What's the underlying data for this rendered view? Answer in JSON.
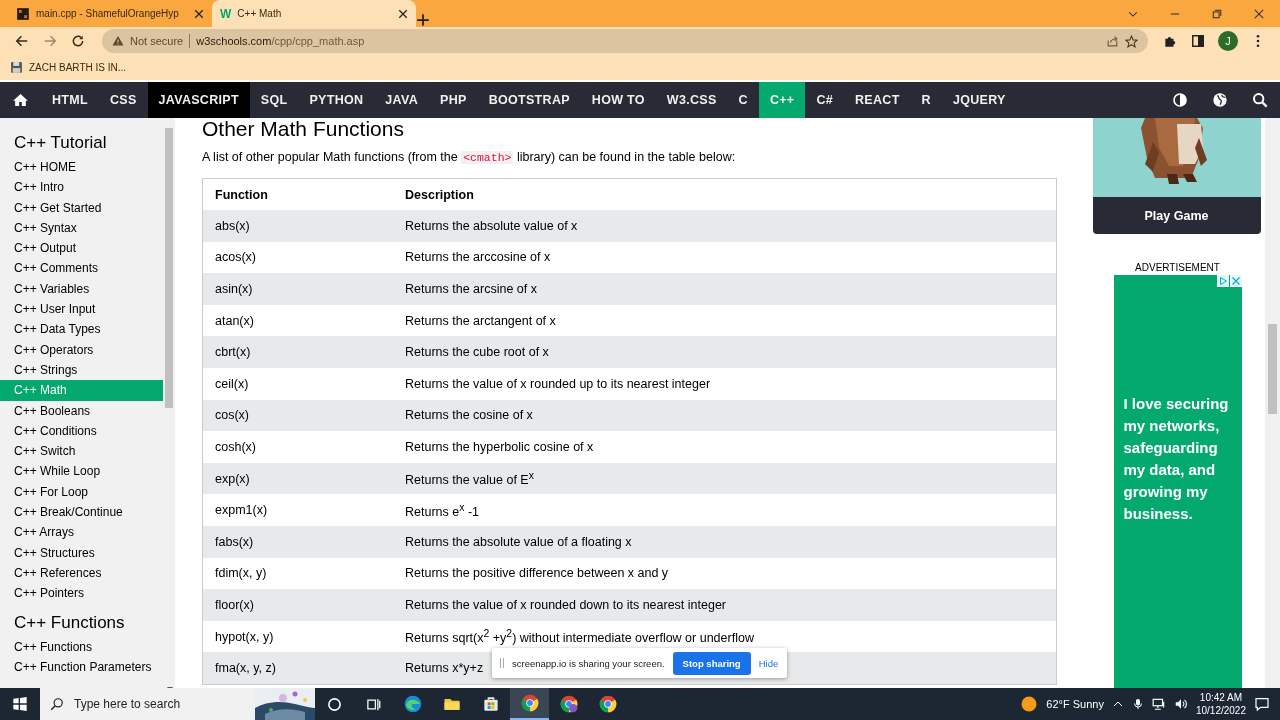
{
  "browser": {
    "tabs": [
      {
        "kind": "replit",
        "title": "main.cpp - ShamefulOrangeHyp",
        "selected": false
      },
      {
        "kind": "w3",
        "favicon": "W",
        "title": "C++ Math",
        "selected": true
      }
    ],
    "security": "Not secure",
    "url_host": "w3schools.com",
    "url_path": "/cpp/cpp_math.asp",
    "avatar": "J",
    "bookmarks": [
      {
        "label": "ZACH BARTH IS IN..."
      }
    ]
  },
  "nav": {
    "items": [
      {
        "label": "HTML",
        "selected": false,
        "hovered": false
      },
      {
        "label": "CSS",
        "selected": false,
        "hovered": false
      },
      {
        "label": "JAVASCRIPT",
        "selected": false,
        "hovered": true
      },
      {
        "label": "SQL",
        "selected": false,
        "hovered": false
      },
      {
        "label": "PYTHON",
        "selected": false,
        "hovered": false
      },
      {
        "label": "JAVA",
        "selected": false,
        "hovered": false
      },
      {
        "label": "PHP",
        "selected": false,
        "hovered": false
      },
      {
        "label": "BOOTSTRAP",
        "selected": false,
        "hovered": false
      },
      {
        "label": "HOW TO",
        "selected": false,
        "hovered": false
      },
      {
        "label": "W3.CSS",
        "selected": false,
        "hovered": false
      },
      {
        "label": "C",
        "selected": false,
        "hovered": false
      },
      {
        "label": "C++",
        "selected": true,
        "hovered": false
      },
      {
        "label": "C#",
        "selected": false,
        "hovered": false
      },
      {
        "label": "REACT",
        "selected": false,
        "hovered": false
      },
      {
        "label": "R",
        "selected": false,
        "hovered": false
      },
      {
        "label": "JQUERY",
        "selected": false,
        "hovered": false
      }
    ]
  },
  "sidebar": {
    "sections": [
      {
        "title": "C++ Tutorial",
        "items": [
          {
            "label": "C++ HOME",
            "selected": false
          },
          {
            "label": "C++ Intro",
            "selected": false
          },
          {
            "label": "C++ Get Started",
            "selected": false
          },
          {
            "label": "C++ Syntax",
            "selected": false
          },
          {
            "label": "C++ Output",
            "selected": false
          },
          {
            "label": "C++ Comments",
            "selected": false
          },
          {
            "label": "C++ Variables",
            "selected": false
          },
          {
            "label": "C++ User Input",
            "selected": false
          },
          {
            "label": "C++ Data Types",
            "selected": false
          },
          {
            "label": "C++ Operators",
            "selected": false
          },
          {
            "label": "C++ Strings",
            "selected": false
          },
          {
            "label": "C++ Math",
            "selected": true
          },
          {
            "label": "C++ Booleans",
            "selected": false
          },
          {
            "label": "C++ Conditions",
            "selected": false
          },
          {
            "label": "C++ Switch",
            "selected": false
          },
          {
            "label": "C++ While Loop",
            "selected": false
          },
          {
            "label": "C++ For Loop",
            "selected": false
          },
          {
            "label": "C++ Break/Continue",
            "selected": false
          },
          {
            "label": "C++ Arrays",
            "selected": false
          },
          {
            "label": "C++ Structures",
            "selected": false
          },
          {
            "label": "C++ References",
            "selected": false
          },
          {
            "label": "C++ Pointers",
            "selected": false
          }
        ]
      },
      {
        "title": "C++ Functions",
        "items": [
          {
            "label": "C++ Functions",
            "selected": false
          },
          {
            "label": "C++ Function Parameters",
            "selected": false
          }
        ]
      }
    ]
  },
  "main": {
    "heading": "Other Math Functions",
    "intro": {
      "before": "A list of other popular Math functions (from the ",
      "code": "<cmath>",
      "after": " library) can be found in the table below:"
    },
    "table": {
      "columns": [
        "Function",
        "Description"
      ],
      "rows": [
        {
          "function": "abs(x)",
          "description": "Returns the absolute value of x"
        },
        {
          "function": "acos(x)",
          "description": "Returns the arccosine of x"
        },
        {
          "function": "asin(x)",
          "description": "Returns the arcsine of x"
        },
        {
          "function": "atan(x)",
          "description": "Returns the arctangent of x"
        },
        {
          "function": "cbrt(x)",
          "description": "Returns the cube root of x"
        },
        {
          "function": "ceil(x)",
          "description": "Returns the value of x rounded up to its nearest integer"
        },
        {
          "function": "cos(x)",
          "description": "Returns the cosine of x"
        },
        {
          "function": "cosh(x)",
          "description": "Returns the hyperbolic cosine of x"
        },
        {
          "function": "exp(x)",
          "description": "Returns the value of E$^{x}$"
        },
        {
          "function": "expm1(x)",
          "description": "Returns e$^{x}$ -1"
        },
        {
          "function": "fabs(x)",
          "description": "Returns the absolute value of a floating x"
        },
        {
          "function": "fdim(x, y)",
          "description": "Returns the positive difference between x and y"
        },
        {
          "function": "floor(x)",
          "description": "Returns the value of x rounded down to its nearest integer"
        },
        {
          "function": "hypot(x, y)",
          "description": "Returns sqrt(x$^{2}$ +y$^{2}$) without intermediate overflow or underflow"
        },
        {
          "function": "fma(x, y, z)",
          "description": "Returns x*y+z"
        }
      ]
    }
  },
  "aside": {
    "game": {
      "kind": "picture",
      "button": "Play Game"
    },
    "ad_label": "ADVERTISEMENT",
    "ad_text": "I love securing my networks, safeguarding my data, and growing my business."
  },
  "share_bar": {
    "message": "screenapp.io is sharing your screen.",
    "stop": "Stop sharing",
    "hide": "Hide"
  },
  "taskbar": {
    "search_placeholder": "Type here to search",
    "weather": "62°F Sunny",
    "time": "10:42 AM",
    "date": "10/12/2022",
    "apps": [
      {
        "kind": "edge",
        "active": false
      },
      {
        "kind": "explorer",
        "active": false
      },
      {
        "kind": "store",
        "active": false
      },
      {
        "kind": "chrome",
        "active": true
      },
      {
        "kind": "chrome-profile",
        "active": false
      },
      {
        "kind": "chrome",
        "active": false
      }
    ]
  }
}
